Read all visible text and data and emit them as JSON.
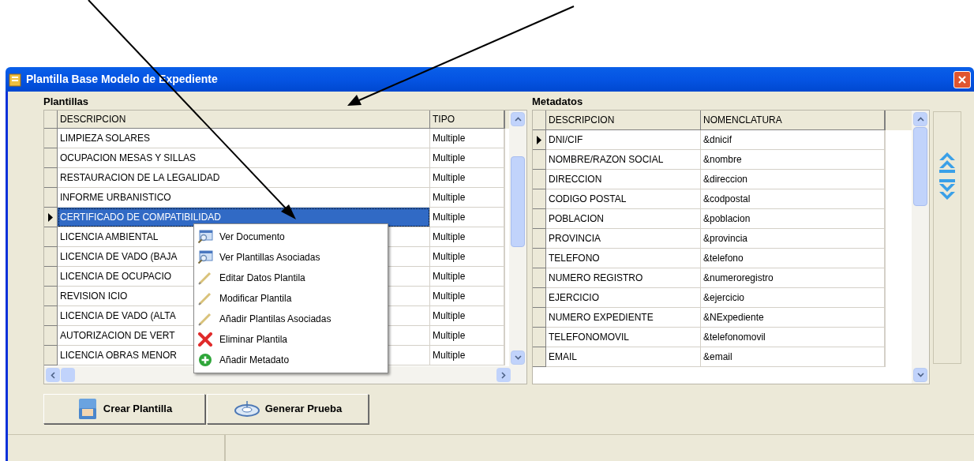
{
  "window": {
    "title": "Plantilla Base Modelo de Expediente"
  },
  "plantillas": {
    "label": "Plantillas",
    "columns": [
      "DESCRIPCION",
      "TIPO"
    ],
    "rows": [
      {
        "descripcion": "LIMPIEZA SOLARES",
        "tipo": "Multiple",
        "selected": false
      },
      {
        "descripcion": "OCUPACION MESAS Y SILLAS",
        "tipo": "Multiple",
        "selected": false
      },
      {
        "descripcion": "RESTAURACION DE LA LEGALIDAD",
        "tipo": "Multiple",
        "selected": false
      },
      {
        "descripcion": "INFORME URBANISTICO",
        "tipo": "Multiple",
        "selected": false
      },
      {
        "descripcion": "CERTIFICADO DE COMPATIBILIDAD",
        "tipo": "Multiple",
        "selected": true
      },
      {
        "descripcion": "LICENCIA AMBIENTAL",
        "tipo": "Multiple",
        "selected": false
      },
      {
        "descripcion": "LICENCIA DE VADO (BAJA",
        "tipo": "Multiple",
        "selected": false
      },
      {
        "descripcion": "LICENCIA DE OCUPACIO",
        "tipo": "Multiple",
        "selected": false
      },
      {
        "descripcion": "REVISION ICIO",
        "tipo": "Multiple",
        "selected": false
      },
      {
        "descripcion": "LICENCIA DE VADO (ALTA",
        "tipo": "Multiple",
        "selected": false
      },
      {
        "descripcion": "AUTORIZACION DE VERT",
        "tipo": "Multiple",
        "selected": false
      },
      {
        "descripcion": "LICENCIA OBRAS MENOR",
        "tipo": "Multiple",
        "selected": false
      }
    ]
  },
  "context_menu": [
    {
      "label": "Ver Documento",
      "kind": "view"
    },
    {
      "label": "Ver Plantillas Asociadas",
      "kind": "view"
    },
    {
      "label": "Editar Datos Plantila",
      "kind": "edit"
    },
    {
      "label": "Modificar Plantila",
      "kind": "edit"
    },
    {
      "label": "Añadir Plantilas Asociadas",
      "kind": "edit"
    },
    {
      "label": "Eliminar Plantila",
      "kind": "delete"
    },
    {
      "label": "Añadir Metadato",
      "kind": "add"
    }
  ],
  "metadatos": {
    "label": "Metadatos",
    "columns": [
      "DESCRIPCION",
      "NOMENCLATURA"
    ],
    "rows": [
      {
        "descripcion": "DNI/CIF",
        "nomenclatura": "&dnicif",
        "selected": true
      },
      {
        "descripcion": "NOMBRE/RAZON SOCIAL",
        "nomenclatura": "&nombre",
        "selected": false
      },
      {
        "descripcion": "DIRECCION",
        "nomenclatura": "&direccion",
        "selected": false
      },
      {
        "descripcion": "CODIGO POSTAL",
        "nomenclatura": "&codpostal",
        "selected": false
      },
      {
        "descripcion": "POBLACION",
        "nomenclatura": "&poblacion",
        "selected": false
      },
      {
        "descripcion": "PROVINCIA",
        "nomenclatura": "&provincia",
        "selected": false
      },
      {
        "descripcion": "TELEFONO",
        "nomenclatura": "&telefono",
        "selected": false
      },
      {
        "descripcion": "NUMERO REGISTRO",
        "nomenclatura": "&numeroregistro",
        "selected": false
      },
      {
        "descripcion": "EJERCICIO",
        "nomenclatura": "&ejercicio",
        "selected": false
      },
      {
        "descripcion": "NUMERO EXPEDIENTE",
        "nomenclatura": "&NExpediente",
        "selected": false
      },
      {
        "descripcion": "TELEFONOMOVIL",
        "nomenclatura": "&telefonomovil",
        "selected": false
      },
      {
        "descripcion": "EMAIL",
        "nomenclatura": "&email",
        "selected": false
      }
    ]
  },
  "buttons": [
    {
      "label": "Crear Plantilla",
      "kind": "create"
    },
    {
      "label": "Generar Prueba",
      "kind": "test"
    }
  ]
}
